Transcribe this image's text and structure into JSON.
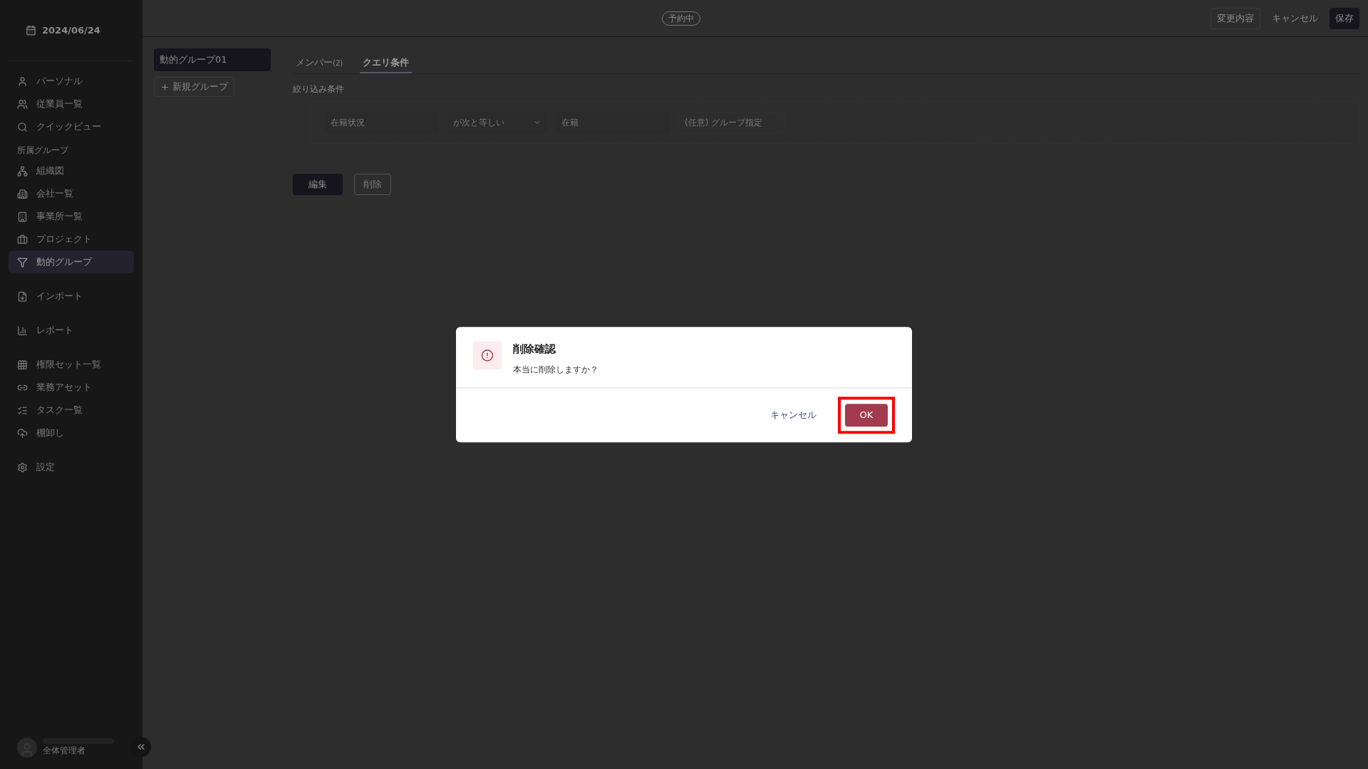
{
  "sidebar": {
    "date": "2024/06/24",
    "nav": [
      {
        "kind": "item",
        "label": "パーソナル",
        "selected": false
      },
      {
        "kind": "item",
        "label": "従業員一覧",
        "selected": false
      },
      {
        "kind": "item",
        "label": "クイックビュー",
        "selected": false
      },
      {
        "kind": "header",
        "label": "所属グループ"
      },
      {
        "kind": "item",
        "label": "組織図",
        "selected": false
      },
      {
        "kind": "item",
        "label": "会社一覧",
        "selected": false
      },
      {
        "kind": "item",
        "label": "事業所一覧",
        "selected": false
      },
      {
        "kind": "item",
        "label": "プロジェクト",
        "selected": false
      },
      {
        "kind": "item",
        "label": "動的グループ",
        "selected": true
      },
      {
        "kind": "gap"
      },
      {
        "kind": "item",
        "label": "インポート",
        "selected": false
      },
      {
        "kind": "gap"
      },
      {
        "kind": "item",
        "label": "レポート",
        "selected": false
      },
      {
        "kind": "gap"
      },
      {
        "kind": "item",
        "label": "権限セット一覧",
        "selected": false
      },
      {
        "kind": "item",
        "label": "業務アセット",
        "selected": false
      },
      {
        "kind": "item",
        "label": "タスク一覧",
        "selected": false
      },
      {
        "kind": "item",
        "label": "棚卸し",
        "selected": false
      },
      {
        "kind": "gap"
      },
      {
        "kind": "item",
        "label": "設定",
        "selected": false
      }
    ],
    "user": {
      "role": "全体管理者"
    }
  },
  "top_bar": {
    "status_badge": "予約中",
    "buttons": [
      {
        "label": "変更内容",
        "kind": "outline"
      },
      {
        "label": "キャンセル",
        "kind": "text"
      },
      {
        "label": "保存",
        "kind": "primary"
      }
    ]
  },
  "group_list": {
    "items": [
      {
        "label": "動的グループ01",
        "selected": true
      }
    ],
    "new_button": "新規グループ"
  },
  "tabs": [
    {
      "label": "メンバー",
      "count": "(2)",
      "selected": false
    },
    {
      "label": "クエリ条件",
      "selected": true
    }
  ],
  "filter": {
    "title": "絞り込み条件",
    "fields": [
      {
        "kind": "text",
        "value": "在籍状況"
      },
      {
        "kind": "select",
        "value": "が次と等しい"
      },
      {
        "kind": "text",
        "value": "在籍"
      },
      {
        "kind": "input",
        "placeholder": "(任意) グループ指定"
      }
    ]
  },
  "actions": [
    {
      "label": "編集",
      "kind": "primary"
    },
    {
      "label": "削除",
      "kind": "outline"
    }
  ],
  "dialog": {
    "title": "削除確認",
    "message": "本当に削除しますか？",
    "buttons": [
      {
        "label": "キャンセル",
        "kind": "text",
        "highlighted": false
      },
      {
        "label": "OK",
        "kind": "danger",
        "highlighted": true
      }
    ]
  }
}
